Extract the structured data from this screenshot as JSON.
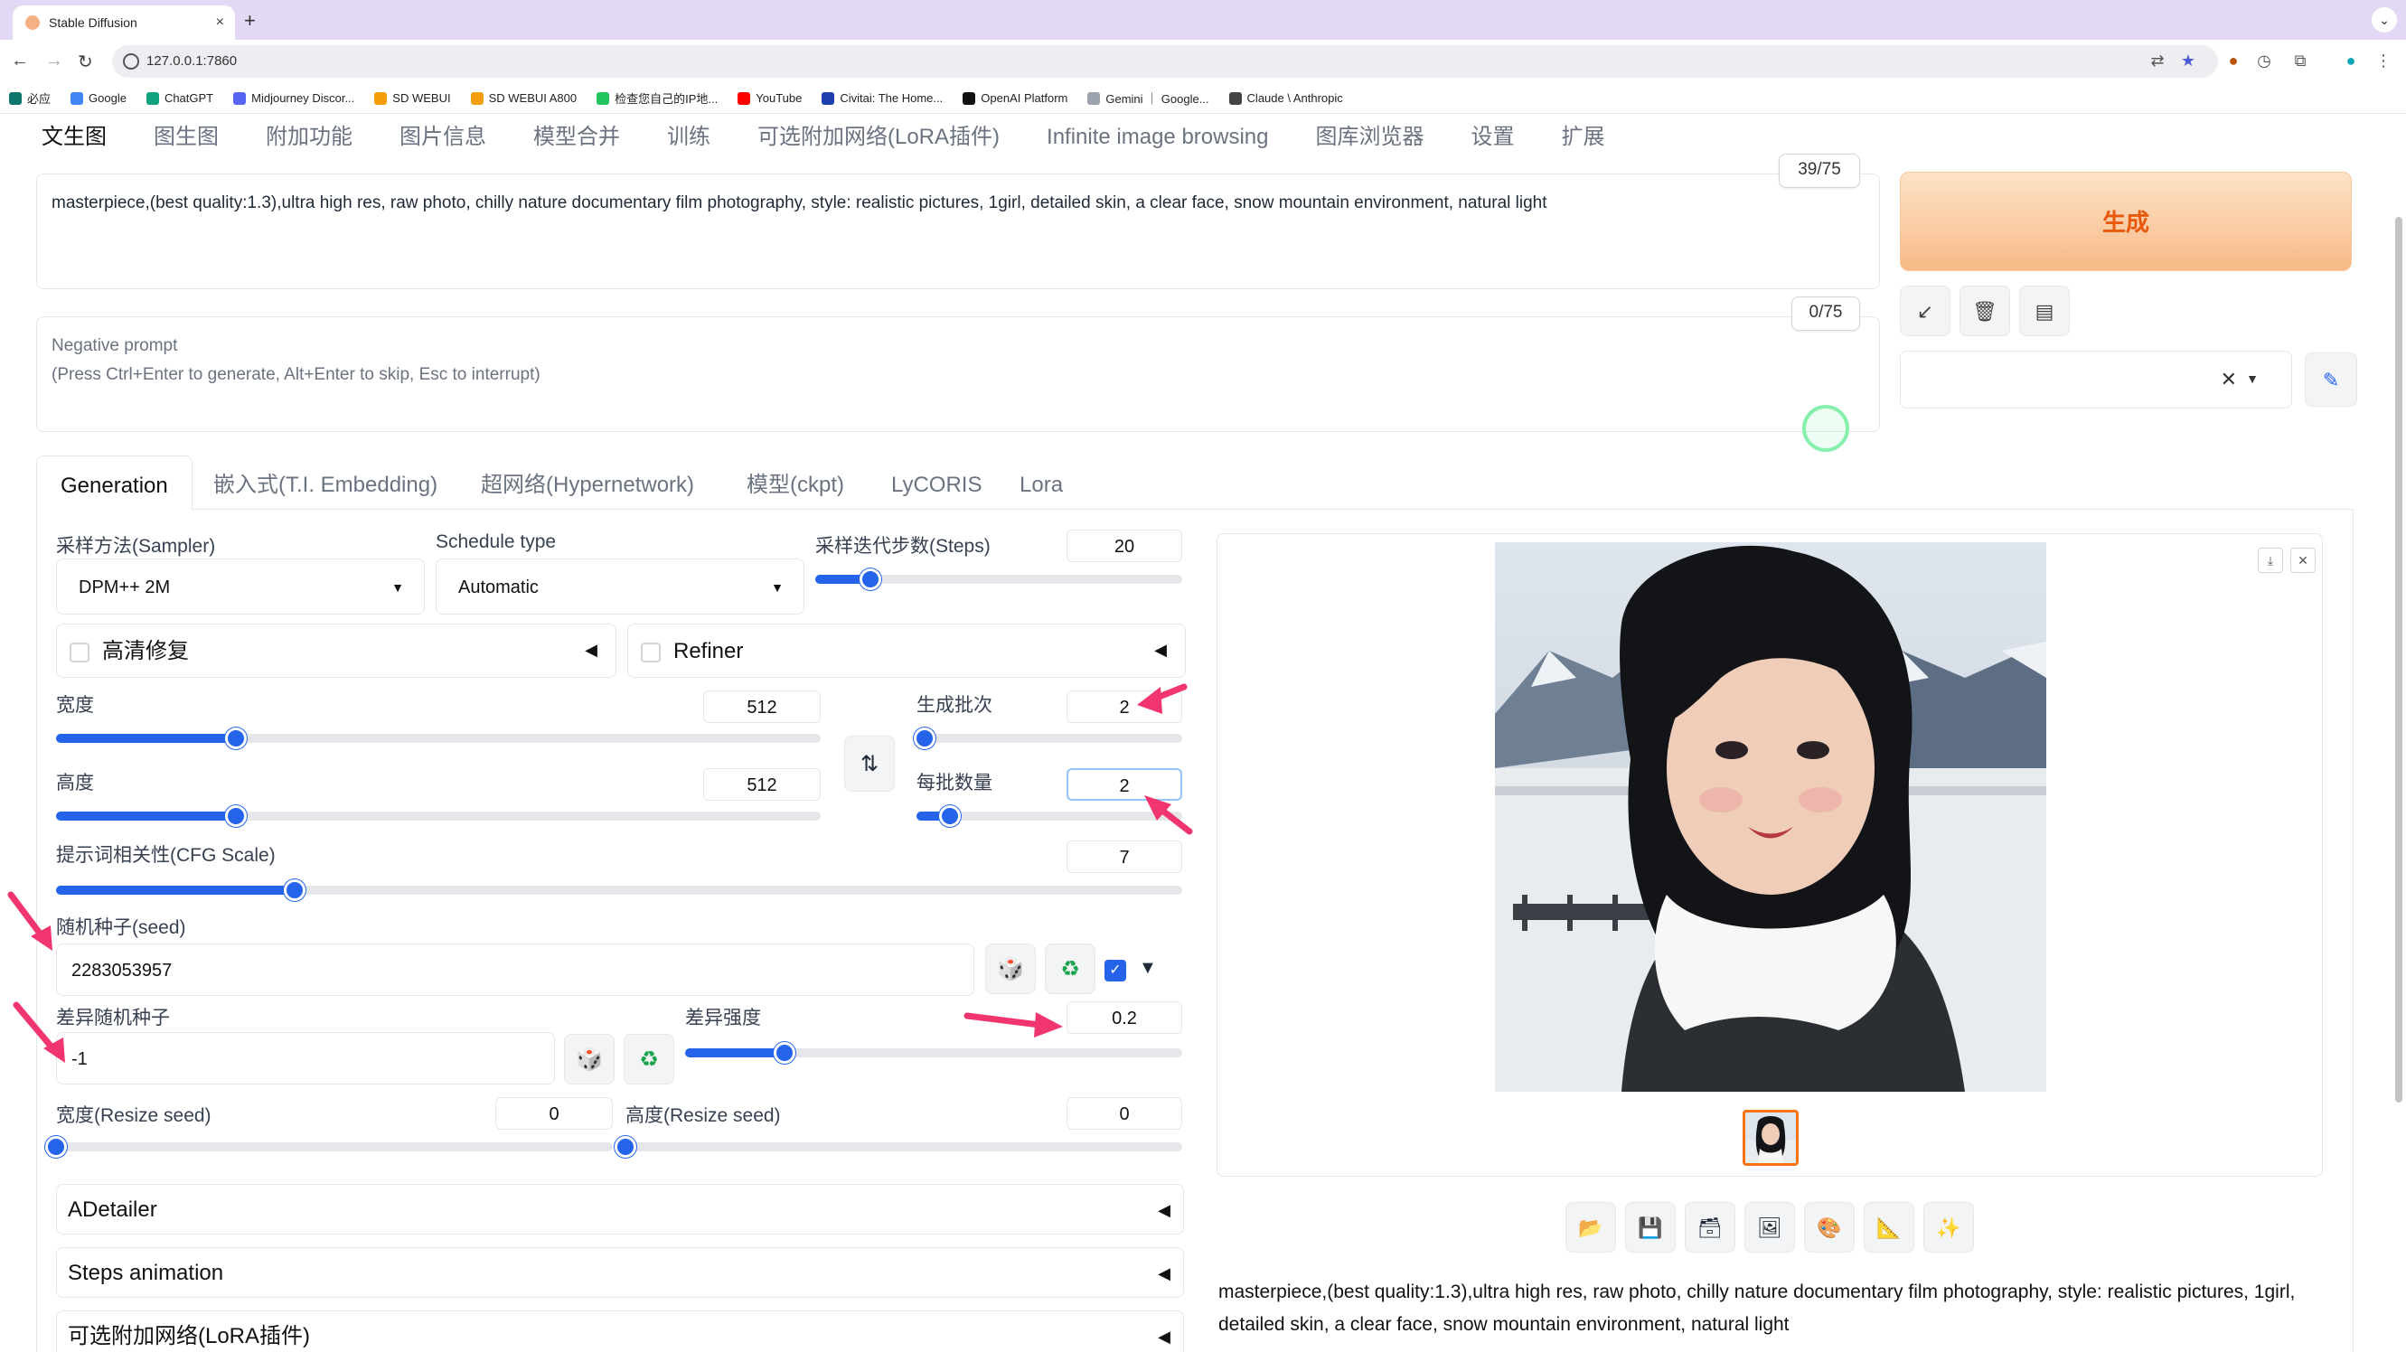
{
  "browser": {
    "tab_title": "Stable Diffusion",
    "tab_close": "×",
    "new_tab": "+",
    "tab_menu": "⌄",
    "url": "127.0.0.1:7860",
    "bookmarks": [
      {
        "label": "必应",
        "color": "#0f766e"
      },
      {
        "label": "Google",
        "color": "#4285f4"
      },
      {
        "label": "ChatGPT",
        "color": "#10a37f"
      },
      {
        "label": "Midjourney Discor...",
        "color": "#5865f2"
      },
      {
        "label": "SD WEBUI",
        "color": "#f59e0b"
      },
      {
        "label": "SD WEBUI A800",
        "color": "#f59e0b"
      },
      {
        "label": "检查您自己的IP地...",
        "color": "#22c55e"
      },
      {
        "label": "YouTube",
        "color": "#ff0000"
      },
      {
        "label": "Civitai: The Home...",
        "color": "#1e40af"
      },
      {
        "label": "OpenAI Platform",
        "color": "#111111"
      },
      {
        "label": "Gemini ｜ Google...",
        "color": "#9ca3af"
      },
      {
        "label": "Claude \\ Anthropic",
        "color": "#444444"
      }
    ]
  },
  "main_tabs": [
    "文生图",
    "图生图",
    "附加功能",
    "图片信息",
    "模型合并",
    "训练",
    "可选附加网络(LoRA插件)",
    "Infinite image browsing",
    "图库浏览器",
    "设置",
    "扩展"
  ],
  "prompt": {
    "text": "masterpiece,(best quality:1.3),ultra high res, raw photo, chilly nature documentary film photography, style: realistic pictures, 1girl, detailed skin, a clear face, snow mountain environment, natural light",
    "counter": "39/75"
  },
  "negative_prompt": {
    "placeholder": "Negative prompt\n(Press Ctrl+Enter to generate, Alt+Enter to skip, Esc to interrupt)",
    "counter": "0/75"
  },
  "generate_label": "生成",
  "sub_tabs": [
    "Generation",
    "嵌入式(T.I. Embedding)",
    "超网络(Hypernetwork)",
    "模型(ckpt)",
    "LyCORIS",
    "Lora"
  ],
  "sampler": {
    "label": "采样方法(Sampler)",
    "value": "DPM++ 2M"
  },
  "schedule": {
    "label": "Schedule type",
    "value": "Automatic"
  },
  "steps": {
    "label": "采样迭代步数(Steps)",
    "value": "20",
    "fraction": 0.15
  },
  "hires": {
    "label": "高清修复"
  },
  "refiner": {
    "label": "Refiner"
  },
  "width": {
    "label": "宽度",
    "value": "512",
    "fraction": 0.235
  },
  "height": {
    "label": "高度",
    "value": "512",
    "fraction": 0.235
  },
  "batch_count": {
    "label": "生成批次",
    "value": "2",
    "fraction": 0.03
  },
  "batch_size": {
    "label": "每批数量",
    "value": "2",
    "fraction": 0.125
  },
  "cfg": {
    "label": "提示词相关性(CFG Scale)",
    "value": "7",
    "fraction": 0.212
  },
  "seed": {
    "label": "随机种子(seed)",
    "value": "2283053957"
  },
  "var_seed": {
    "label": "差异随机种子",
    "value": "-1"
  },
  "var_strength": {
    "label": "差异强度",
    "value": "0.2",
    "fraction": 0.2
  },
  "resize_w": {
    "label": "宽度(Resize seed)",
    "value": "0",
    "fraction": 0.0
  },
  "resize_h": {
    "label": "高度(Resize seed)",
    "value": "0",
    "fraction": 0.0
  },
  "accordions": [
    "ADetailer",
    "Steps animation",
    "可选附加网络(LoRA插件)"
  ],
  "output_text": "masterpiece,(best quality:1.3),ultra high res, raw photo, chilly nature documentary film photography, style: realistic pictures, 1girl, detailed skin, a clear face, snow mountain environment, natural light",
  "colors": {
    "accent": "#2563eb",
    "generate": "#f8b987",
    "arrow": "#f0356f"
  }
}
